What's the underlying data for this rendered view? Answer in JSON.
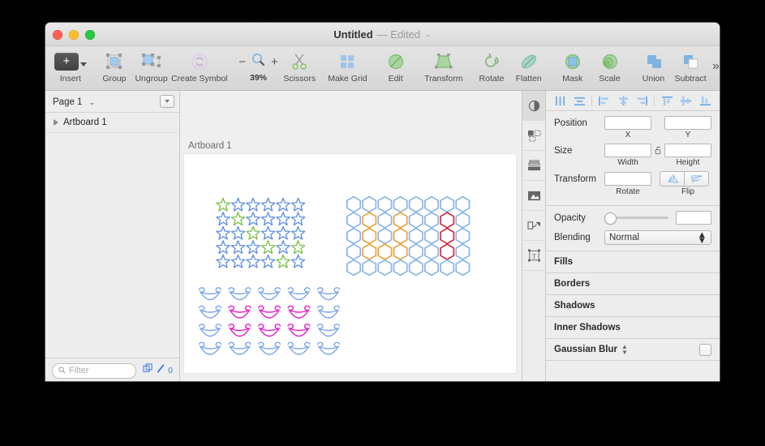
{
  "window": {
    "traffic_lights": [
      "close",
      "minimize",
      "zoom"
    ],
    "title": "Untitled",
    "title_status": "— Edited",
    "title_chevron": "⌄"
  },
  "toolbar": {
    "items": [
      {
        "label": "Insert",
        "icon": "plus-icon",
        "has_dropdown": true
      },
      {
        "label": "Group",
        "icon": "group-icon"
      },
      {
        "label": "Ungroup",
        "icon": "ungroup-icon"
      },
      {
        "label": "Create Symbol",
        "icon": "symbol-icon"
      }
    ],
    "zoom": {
      "minus": "−",
      "plus": "+",
      "level": "39%",
      "icon": "magnifier-icon"
    },
    "tools": [
      {
        "label": "Scissors",
        "icon": "scissors-icon"
      },
      {
        "label": "Make Grid",
        "icon": "grid-icon"
      },
      {
        "label": "Edit",
        "icon": "edit-icon"
      },
      {
        "label": "Transform",
        "icon": "transform-icon"
      },
      {
        "label": "Rotate",
        "icon": "rotate-icon"
      },
      {
        "label": "Flatten",
        "icon": "flatten-icon"
      },
      {
        "label": "Mask",
        "icon": "mask-icon"
      },
      {
        "label": "Scale",
        "icon": "scale-icon"
      },
      {
        "label": "Union",
        "icon": "union-icon"
      },
      {
        "label": "Subtract",
        "icon": "subtract-icon"
      }
    ],
    "overflow": "»"
  },
  "sidebar": {
    "page": {
      "label": "Page 1",
      "chevron": "⌄",
      "menu_icon": "dropdown-button-icon"
    },
    "layers": [
      {
        "name": "Artboard 1",
        "disclosure": "collapsed"
      }
    ],
    "footer": {
      "filter_placeholder": "Filter",
      "search_icon": "search-icon",
      "copy_icon": "duplicate-icon",
      "pen_icon": "pen-icon",
      "count": "0"
    }
  },
  "canvas": {
    "artboard_label": "Artboard 1",
    "background": "#efefef",
    "artboard_background": "#ffffff",
    "groups": [
      {
        "name": "stars-grid",
        "shape": "star",
        "cols": 6,
        "rows": 5,
        "base_color": "#5b8ee0",
        "accent_color": "#76c043",
        "accent_cells": [
          0,
          7,
          14,
          21,
          23,
          28
        ]
      },
      {
        "name": "hexagons-grid",
        "shape": "hexagon",
        "cols": 8,
        "rows": 5,
        "base_color": "#8ab4e8",
        "accent_color": "#e8a33d",
        "accent_cells": [
          9,
          11,
          17,
          19,
          25,
          26,
          27
        ],
        "accent2_color": "#d12e3c",
        "accent2_cells": [
          14,
          22,
          30
        ]
      },
      {
        "name": "bowls-grid",
        "shape": "bowl",
        "cols": 5,
        "rows": 4,
        "base_color": "#7aa6e8",
        "accent_color": "#e020c0",
        "accent_cells": [
          6,
          7,
          8,
          11,
          12,
          13
        ]
      }
    ]
  },
  "inspector_strip": {
    "buttons": [
      {
        "icon": "appearance-icon",
        "selected": true
      },
      {
        "icon": "shapes-icon",
        "selected": false
      },
      {
        "icon": "layers-icon",
        "selected": false
      },
      {
        "icon": "image-icon",
        "selected": false
      },
      {
        "icon": "path-icon",
        "selected": false
      },
      {
        "icon": "text-icon",
        "selected": false
      }
    ]
  },
  "inspector": {
    "align": [
      {
        "icon": "distribute-horizontally-icon"
      },
      {
        "icon": "distribute-vertically-icon"
      },
      {
        "icon": "align-left-icon"
      },
      {
        "icon": "align-center-icon"
      },
      {
        "icon": "align-right-icon"
      },
      {
        "icon": "align-top-icon"
      },
      {
        "icon": "align-middle-icon"
      },
      {
        "icon": "align-bottom-icon"
      }
    ],
    "position": {
      "label": "Position",
      "x_value": "",
      "y_value": "",
      "x_sub": "X",
      "y_sub": "Y"
    },
    "size": {
      "label": "Size",
      "width_value": "",
      "height_value": "",
      "width_sub": "Width",
      "height_sub": "Height",
      "lock_icon": "unlocked-padlock-icon"
    },
    "transform": {
      "label": "Transform",
      "rotate_value": "",
      "rotate_sub": "Rotate",
      "flip_sub": "Flip",
      "flip_horizontal_icon": "flip-horizontal-icon",
      "flip_vertical_icon": "flip-vertical-icon"
    },
    "opacity": {
      "label": "Opacity",
      "value": "",
      "slider_percent": 0
    },
    "blending": {
      "label": "Blending",
      "value": "Normal",
      "stepper_icon": "stepper-icon"
    },
    "sections": [
      {
        "label": "Fills",
        "stepper": false,
        "checkbox": false
      },
      {
        "label": "Borders",
        "stepper": false,
        "checkbox": false
      },
      {
        "label": "Shadows",
        "stepper": false,
        "checkbox": false
      },
      {
        "label": "Inner Shadows",
        "stepper": false,
        "checkbox": false
      },
      {
        "label": "Gaussian Blur",
        "stepper": true,
        "checkbox": true
      }
    ]
  }
}
